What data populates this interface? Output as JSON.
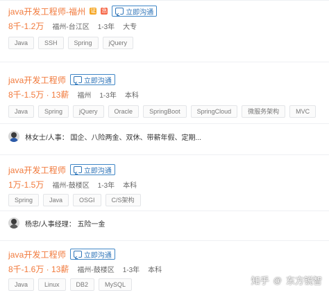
{
  "jobs": [
    {
      "title": "java开发工程师-福州",
      "chat_label": "立即沟通",
      "salary": "8千-1.2万",
      "location": "福州-台江区",
      "experience": "1-3年",
      "education": "大专",
      "tags": [
        "Java",
        "SSH",
        "Spring",
        "jQuery"
      ]
    },
    {
      "title": "java开发工程师",
      "chat_label": "立即沟通",
      "salary": "8千-1.5万 · 13薪",
      "location": "福州",
      "experience": "1-3年",
      "education": "本科",
      "tags": [
        "Java",
        "Spring",
        "jQuery",
        "Oracle",
        "SpringBoot",
        "SpringCloud",
        "微服务架构",
        "MVC"
      ],
      "contact": "林女士/人事：  国企、八险两金、双休、带薪年假、定期..."
    },
    {
      "title": "java开发工程师",
      "chat_label": "立即沟通",
      "salary": "1万-1.5万",
      "location": "福州-鼓楼区",
      "experience": "1-3年",
      "education": "本科",
      "tags": [
        "Spring",
        "Java",
        "OSGI",
        "C/S架构"
      ],
      "contact": "杨忠/人事经理：  五险一金"
    },
    {
      "title": "java开发工程师",
      "chat_label": "立即沟通",
      "salary": "8千-1.6万 · 13薪",
      "location": "福州-鼓楼区",
      "experience": "1-3年",
      "education": "本科",
      "tags": [
        "Java",
        "Linux",
        "DB2",
        "MySQL"
      ]
    }
  ],
  "watermark": {
    "site": "知乎",
    "at": "@",
    "author": "东方锐智"
  },
  "colors": {
    "accent": "#f1793b",
    "link_blue": "#2d73b7"
  }
}
